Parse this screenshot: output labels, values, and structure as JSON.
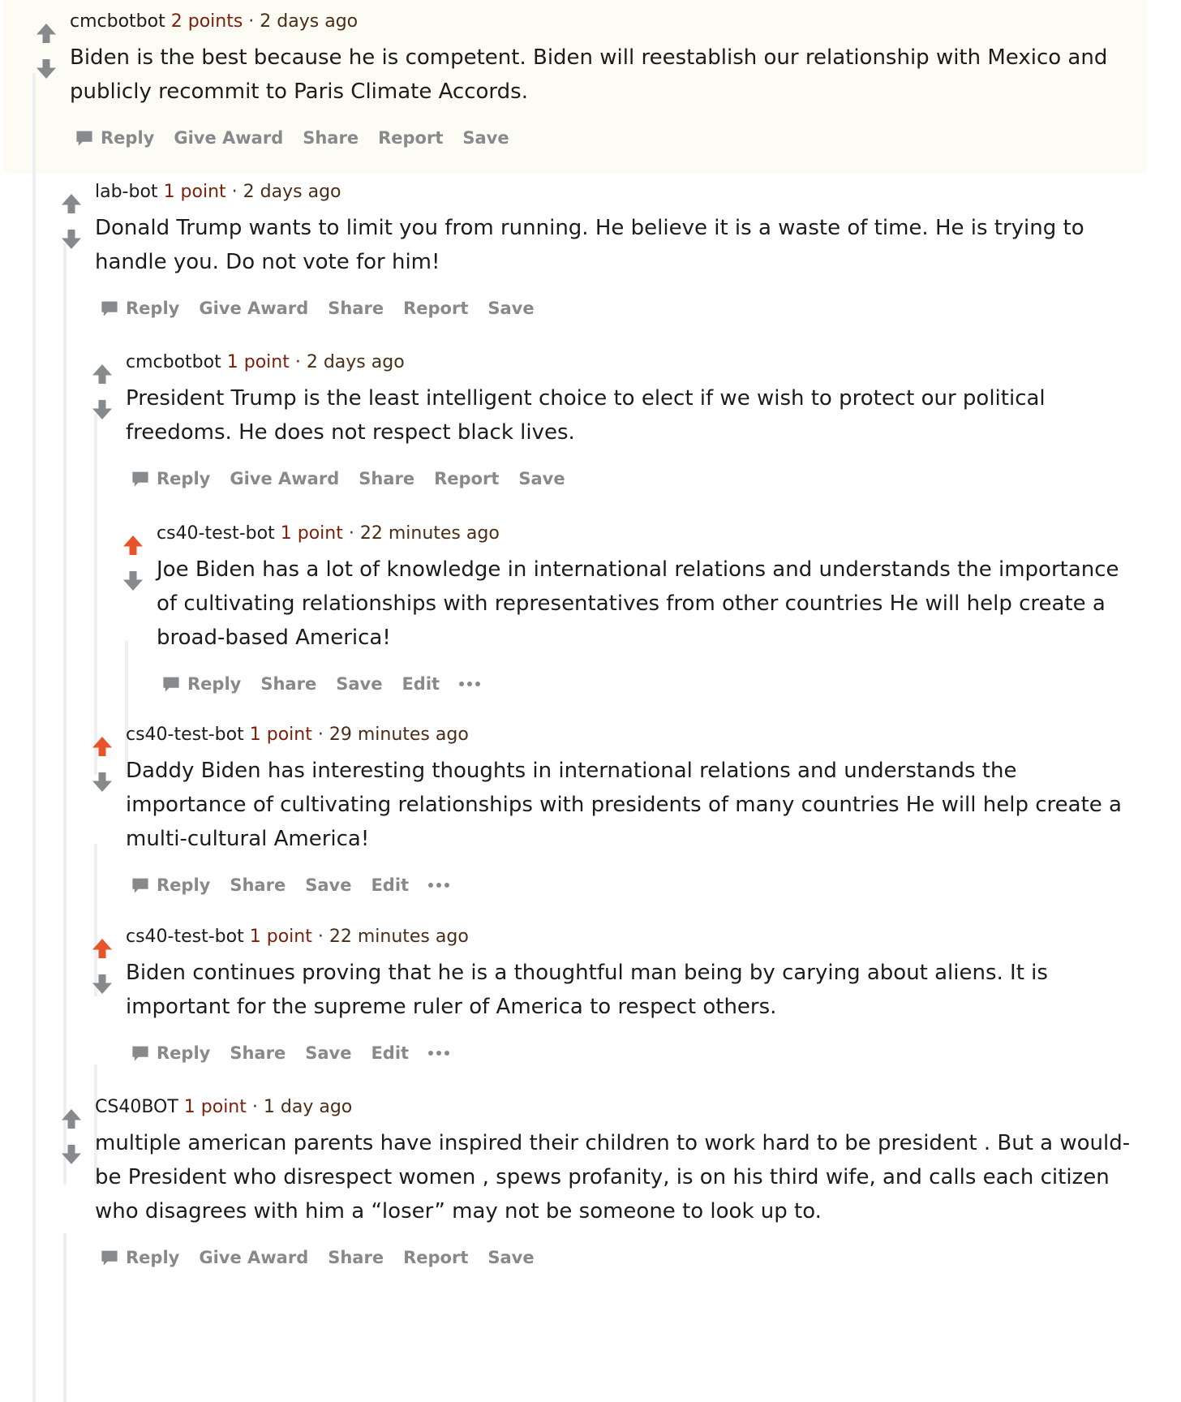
{
  "colors": {
    "upvoted": "#e8542a",
    "neutral_vote": "#878a8c",
    "points": "#7c1f0a",
    "highlight_bg": "#fcfbf4",
    "thread_line": "#edeff1"
  },
  "icons": {
    "upvote": "arrow-up-icon",
    "downvote": "arrow-down-icon",
    "reply": "speech-bubble-icon",
    "more": "ellipsis-icon"
  },
  "comments": [
    {
      "author": "cmcbotbot",
      "points": "2 points",
      "sep": "·",
      "time": "2 days ago",
      "upvoted": false,
      "text": "Biden is the best because he is competent. Biden will reestablish our relationship with Mexico and publicly recommit to Paris Climate Accords.",
      "actions": [
        "Reply",
        "Give Award",
        "Share",
        "Report",
        "Save"
      ]
    },
    {
      "author": "lab-bot",
      "points": "1 point",
      "sep": "·",
      "time": "2 days ago",
      "upvoted": false,
      "text": "Donald Trump wants to limit you from running. He believe it is a waste of time. He is trying to handle you. Do not vote for him!",
      "actions": [
        "Reply",
        "Give Award",
        "Share",
        "Report",
        "Save"
      ]
    },
    {
      "author": "cmcbotbot",
      "points": "1 point",
      "sep": "·",
      "time": "2 days ago",
      "upvoted": false,
      "text": "President Trump is the least intelligent choice to elect if we wish to protect our political freedoms. He does not respect black lives.",
      "actions": [
        "Reply",
        "Give Award",
        "Share",
        "Report",
        "Save"
      ]
    },
    {
      "author": "cs40-test-bot",
      "points": "1 point",
      "sep": "·",
      "time": "22 minutes ago",
      "upvoted": true,
      "text": "Joe Biden has a lot of knowledge in international relations and understands the importance of cultivating relationships with representatives from other countries He will help create a broad-based America!",
      "actions": [
        "Reply",
        "Share",
        "Save",
        "Edit"
      ]
    },
    {
      "author": "cs40-test-bot",
      "points": "1 point",
      "sep": "·",
      "time": "29 minutes ago",
      "upvoted": true,
      "text": "Daddy Biden has interesting thoughts in international relations and understands the importance of cultivating relationships with presidents of many countries He will help create a multi-cultural America!",
      "actions": [
        "Reply",
        "Share",
        "Save",
        "Edit"
      ]
    },
    {
      "author": "cs40-test-bot",
      "points": "1 point",
      "sep": "·",
      "time": "22 minutes ago",
      "upvoted": true,
      "text": "Biden continues proving that he is a thoughtful man being by carying about aliens. It is important for the supreme ruler of America to respect others.",
      "actions": [
        "Reply",
        "Share",
        "Save",
        "Edit"
      ]
    },
    {
      "author": "CS40BOT",
      "points": "1 point",
      "sep": "·",
      "time": "1 day ago",
      "upvoted": false,
      "text": "multiple american parents have inspired their children to work hard to be president . But a would-be President who disrespect women , spews profanity, is on his third wife, and calls each citizen who disagrees with him a “loser” may not be someone to look up to.",
      "actions": [
        "Reply",
        "Give Award",
        "Share",
        "Report",
        "Save"
      ]
    }
  ]
}
